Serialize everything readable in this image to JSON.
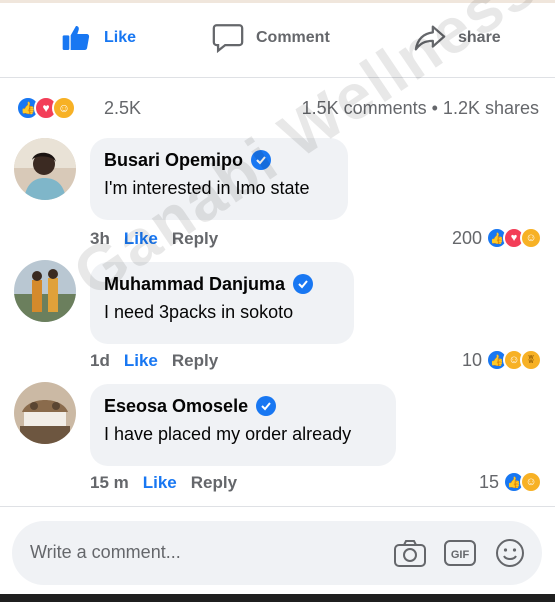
{
  "actions": {
    "like_label": "Like",
    "comment_label": "Comment",
    "share_label": "share"
  },
  "summary": {
    "reaction_icons": [
      "like-icon",
      "love-icon",
      "care-icon"
    ],
    "reaction_count": "2.5K",
    "comments_shares": "1.5K comments • 1.2K shares"
  },
  "comments": [
    {
      "author": "Busari Opemipo",
      "text": "I'm interested in Imo state",
      "time": "3h",
      "like_label": "Like",
      "reply_label": "Reply",
      "reactions_count": "200",
      "reaction_icons": [
        "like-icon",
        "love-icon",
        "care-icon"
      ]
    },
    {
      "author": "Muhammad Danjuma",
      "text": "I need 3packs in sokoto",
      "time": "1d",
      "like_label": "Like",
      "reply_label": "Reply",
      "reactions_count": "10",
      "reaction_icons": [
        "like-icon",
        "care-icon",
        "haha-icon"
      ]
    },
    {
      "author": "Eseosa Omosele",
      "text": "I have placed my order already",
      "time": "15 m",
      "like_label": "Like",
      "reply_label": "Reply",
      "reactions_count": "15",
      "reaction_icons": [
        "like-icon",
        "care-icon"
      ]
    }
  ],
  "composer": {
    "placeholder": "Write a comment...",
    "gif_label": "GIF"
  },
  "watermark": "Ganabi Wellness",
  "colors": {
    "brand_blue": "#1877f2",
    "love_red": "#f33e58",
    "care_yellow": "#f7b125",
    "muted_text": "#65676b",
    "bubble_bg": "#f0f2f5"
  }
}
